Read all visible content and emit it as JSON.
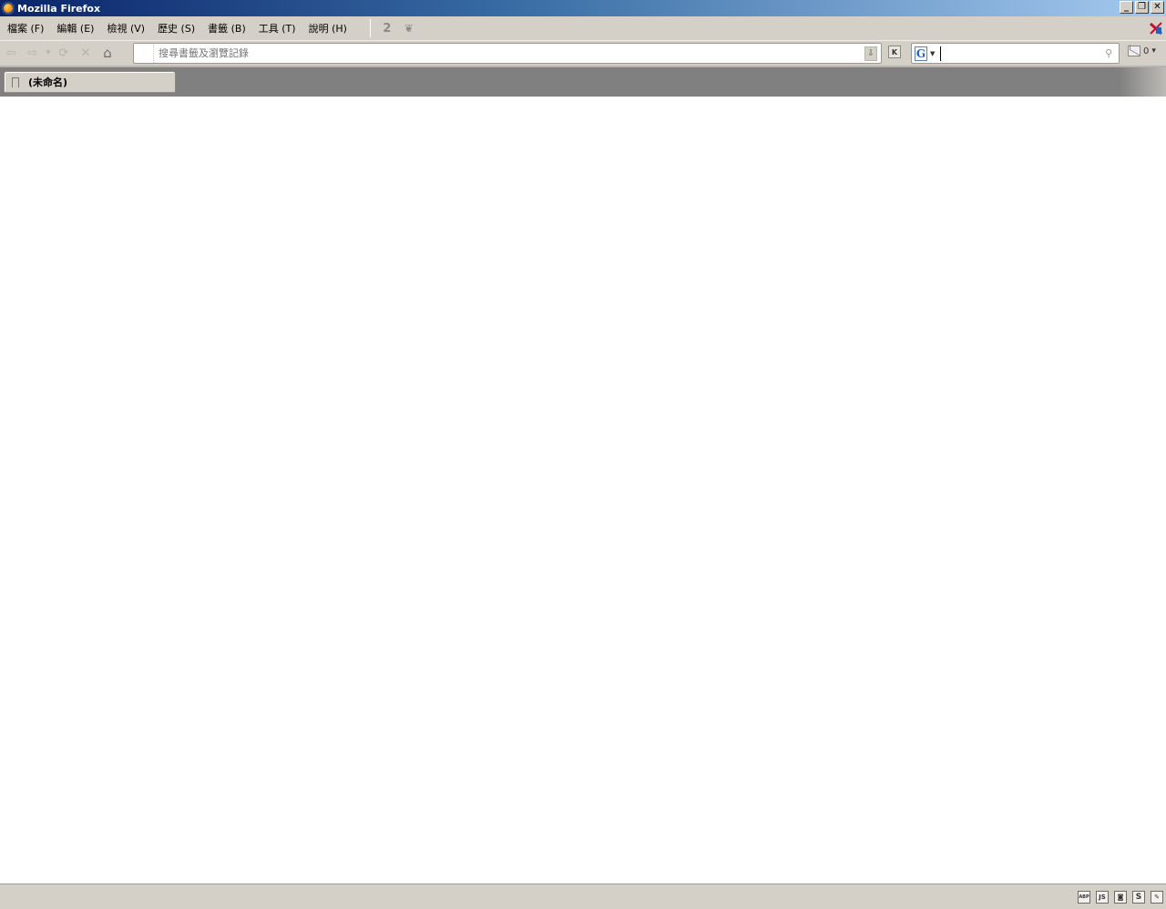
{
  "window": {
    "title": "Mozilla Firefox",
    "controls": {
      "minimize": "_",
      "restore": "❐",
      "close": "✕"
    }
  },
  "menubar": {
    "items": [
      {
        "label": "檔案 (F)"
      },
      {
        "label": "編輯 (E)"
      },
      {
        "label": "檢視 (V)"
      },
      {
        "label": "歷史 (S)"
      },
      {
        "label": "書籤 (B)"
      },
      {
        "label": "工具 (T)"
      },
      {
        "label": "說明 (H)"
      }
    ],
    "toolbar_icons": [
      "two-icon",
      "leaf-icon"
    ],
    "toolbar_glyphs": {
      "two": "2",
      "leaf": "❦"
    }
  },
  "navbar": {
    "back": "⇦",
    "forward": "⇨",
    "dropdown": "▾",
    "reload": "⟳",
    "stop": "✕",
    "home": "⌂",
    "url": {
      "value": "",
      "placeholder": "搜尋書籤及瀏覽記錄"
    },
    "url_drop_glyph": "⇩",
    "k_button": "K",
    "search": {
      "engine_glyph": "G",
      "value": "",
      "placeholder": ""
    },
    "search_go_glyph": "⚲",
    "mail_count": "0",
    "mail_caret": "▾"
  },
  "tabs": [
    {
      "label": "(未命名)",
      "active": true
    }
  ],
  "statusbar": {
    "text": "",
    "icons": [
      {
        "name": "adblock-icon",
        "glyph": "ABP"
      },
      {
        "name": "js-icon",
        "glyph": "JS"
      },
      {
        "name": "camera-icon",
        "glyph": "◙"
      },
      {
        "name": "s-icon",
        "glyph": "S"
      },
      {
        "name": "puzzle-icon",
        "glyph": "✎"
      }
    ]
  },
  "colors": {
    "titlebar_start": "#0a246a",
    "titlebar_end": "#a6caf0",
    "chrome": "#d4d0c8",
    "tabstrip": "#808080"
  }
}
